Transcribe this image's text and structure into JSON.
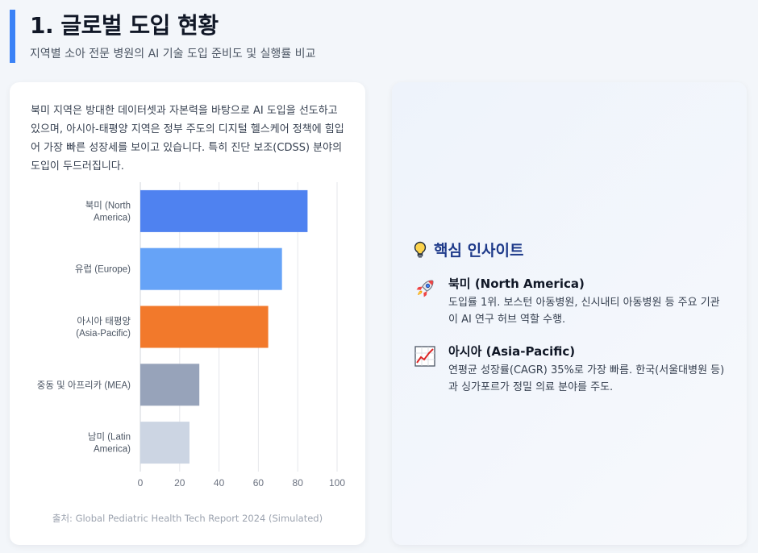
{
  "header": {
    "title": "1. 글로벌 도입 현황",
    "subtitle": "지역별 소아 전문 병원의 AI 기술 도입 준비도 및 실행률 비교"
  },
  "left_card": {
    "description": "북미 지역은 방대한 데이터셋과 자본력을 바탕으로 AI 도입을 선도하고 있으며, 아시아-태평양 지역은 정부 주도의 디지털 헬스케어 정책에 힘입어 가장 빠른 성장세를 보이고 있습니다. 특히 진단 보조(CDSS) 분야의 도입이 두드러집니다.",
    "source": "출처: Global Pediatric Health Tech Report 2024 (Simulated)"
  },
  "chart_data": {
    "type": "bar",
    "orientation": "horizontal",
    "categories": [
      [
        "북미 (North",
        "America)"
      ],
      [
        "유럽 (Europe)"
      ],
      [
        "아시아 태평양",
        "(Asia-Pacific)"
      ],
      [
        "중동 및 아프리카 (MEA)"
      ],
      [
        "남미 (Latin",
        "America)"
      ]
    ],
    "values": [
      85,
      72,
      65,
      30,
      25
    ],
    "colors": [
      "#4f82f0",
      "#66a3f7",
      "#f2792b",
      "#97a3ba",
      "#ccd5e3"
    ],
    "xlim": [
      0,
      100
    ],
    "xticks": [
      0,
      20,
      40,
      60,
      80,
      100
    ],
    "grid": true
  },
  "right_card": {
    "title": "핵심 인사이트",
    "title_icon": "lightbulb-icon",
    "items": [
      {
        "icon": "rocket-icon",
        "heading": "북미 (North America)",
        "text": "도입률 1위. 보스턴 아동병원, 신시내티 아동병원 등 주요 기관이 AI 연구 허브 역할 수행."
      },
      {
        "icon": "chart-increasing-icon",
        "heading": "아시아 (Asia-Pacific)",
        "text": "연평균 성장률(CAGR) 35%로 가장 빠름. 한국(서울대병원 등)과 싱가포르가 정밀 의료 분야를 주도."
      }
    ]
  }
}
